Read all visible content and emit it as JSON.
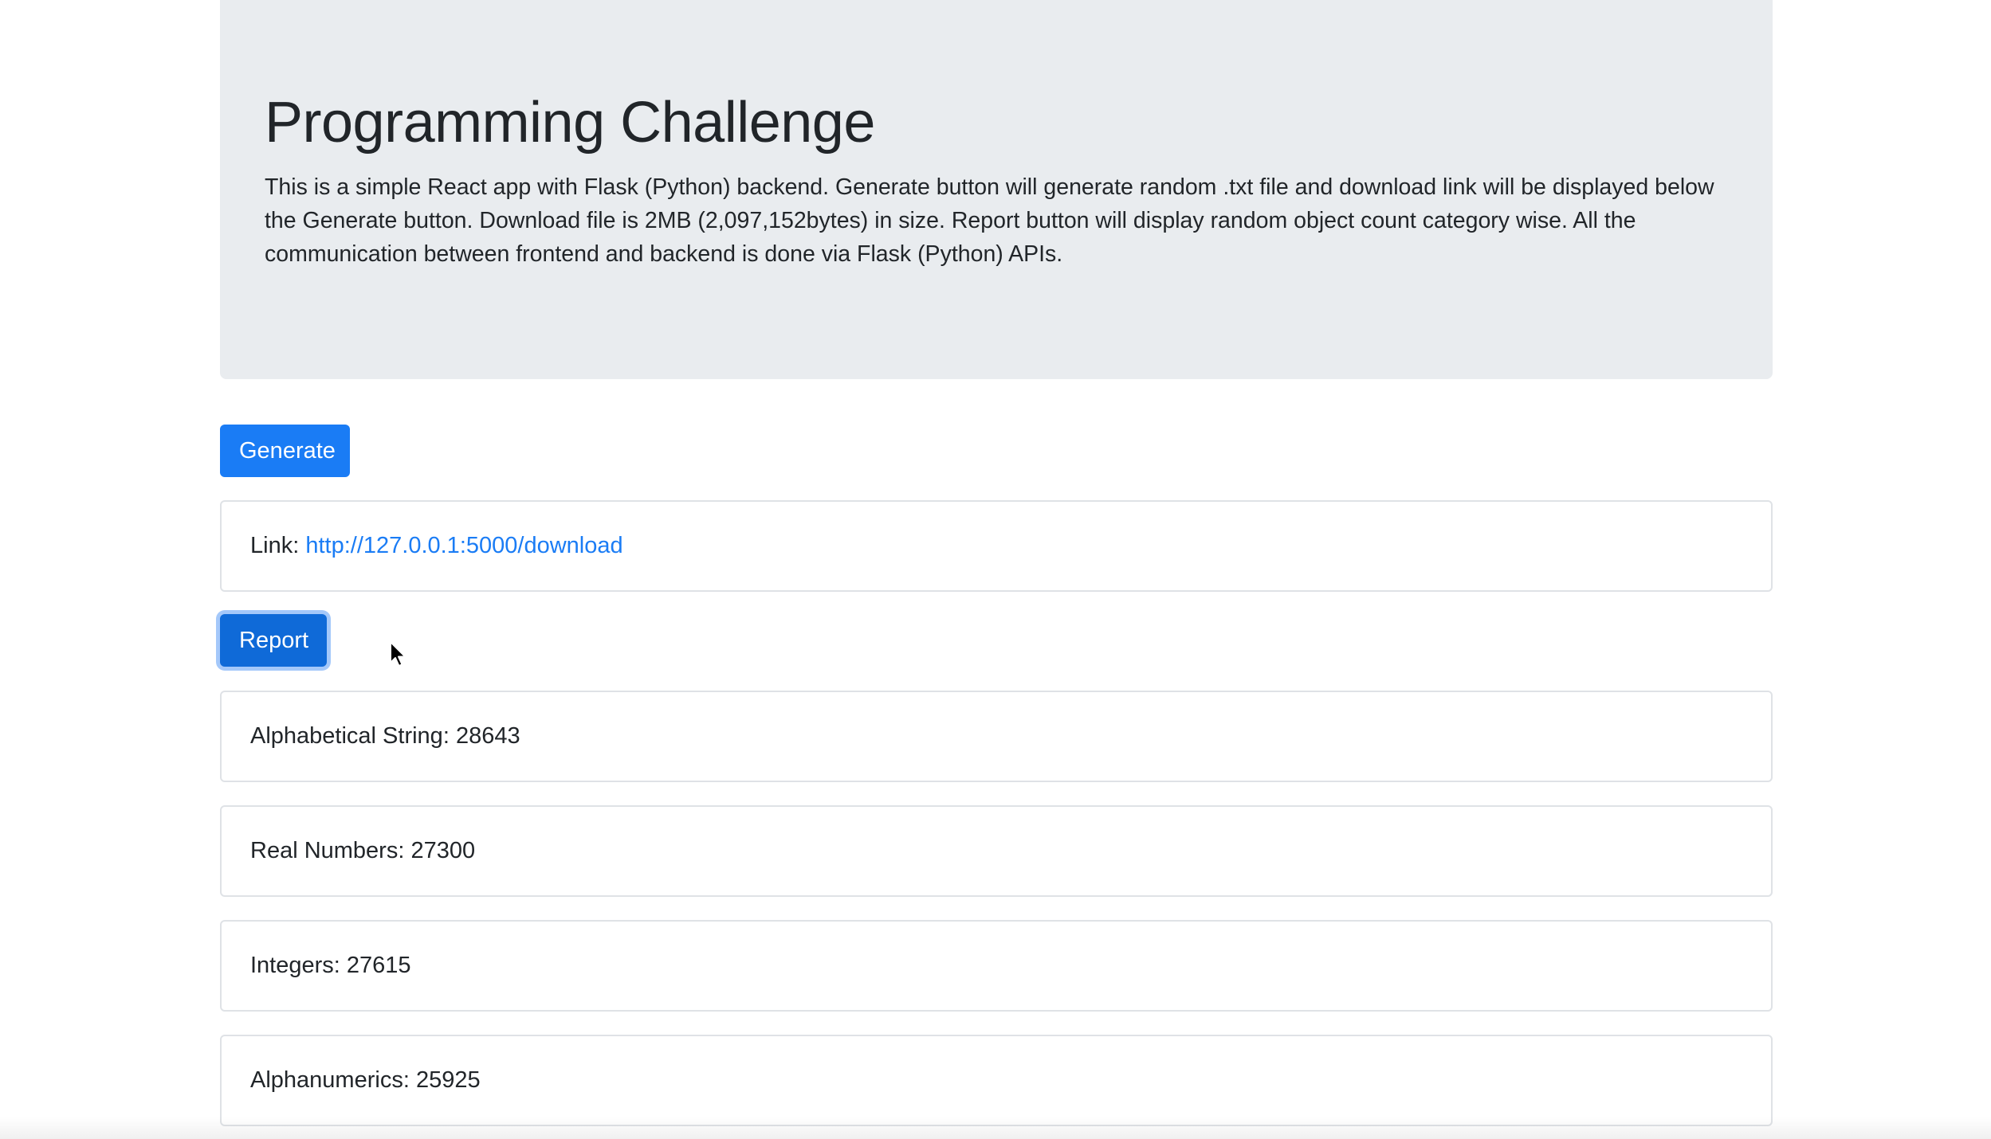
{
  "header": {
    "title": "Programming Challenge",
    "description": "This is a simple React app with Flask (Python) backend. Generate button will generate random .txt file and download link will be displayed below the Generate button. Download file is 2MB (2,097,152bytes) in size. Report button will display random object count category wise. All the communication between frontend and backend is done via Flask (Python) APIs."
  },
  "actions": {
    "generate_label": "Generate",
    "report_label": "Report"
  },
  "link_card": {
    "label": "Link: ",
    "url": "http://127.0.0.1:5000/download"
  },
  "report": {
    "items": [
      {
        "label": "Alphabetical String",
        "count": "28643"
      },
      {
        "label": "Real Numbers",
        "count": "27300"
      },
      {
        "label": "Integers",
        "count": "27615"
      },
      {
        "label": "Alphanumerics",
        "count": "25925"
      }
    ]
  },
  "icons": {
    "cursor": "mouse-pointer-icon"
  },
  "colors": {
    "primary": "#1a7cf5",
    "jumbotron_bg": "#e9ecef",
    "text": "#212529"
  }
}
